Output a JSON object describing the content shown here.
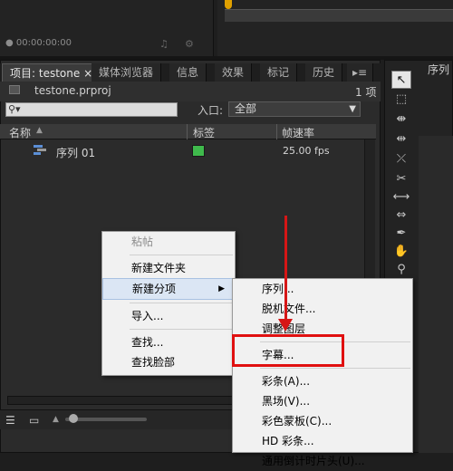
{
  "top": {
    "timecode": "00:00:00:00"
  },
  "tabs": [
    {
      "label": "项目: testone",
      "close": "×",
      "active": true
    },
    {
      "label": "媒体浏览器"
    },
    {
      "label": "信息"
    },
    {
      "label": "效果"
    },
    {
      "label": "标记"
    },
    {
      "label": "历史"
    },
    {
      "label": "▸≡"
    }
  ],
  "right_tab": "序列",
  "project": {
    "filename": "testone.prproj",
    "item_count": "1 项",
    "search_placeholder": "",
    "in_point_label": "入口:",
    "in_point_value": "全部"
  },
  "columns": {
    "name": "名称",
    "label": "标签",
    "framerate": "帧速率"
  },
  "items": [
    {
      "name": "序列 01",
      "label_color": "#3fba4c",
      "framerate": "25.00 fps"
    }
  ],
  "context_menu": {
    "items": [
      {
        "label": "粘帖",
        "disabled": true
      },
      {
        "label": "新建文件夹"
      },
      {
        "label": "新建分项",
        "submenu": true,
        "highlighted": true
      },
      {
        "label": "导入..."
      },
      {
        "label": "查找..."
      },
      {
        "label": "查找脸部"
      }
    ]
  },
  "submenu": {
    "items": [
      {
        "label": "序列..."
      },
      {
        "label": "脱机文件..."
      },
      {
        "label": "调整图层"
      },
      {
        "label": "字幕..."
      },
      {
        "label": "彩条(A)..."
      },
      {
        "label": "黑场(V)..."
      },
      {
        "label": "彩色蒙板(C)..."
      },
      {
        "label": "HD 彩条..."
      },
      {
        "label": "通用倒计时片头(U)..."
      }
    ]
  },
  "colors": {
    "annotation": "#e01010",
    "label_green": "#3fba4c"
  }
}
